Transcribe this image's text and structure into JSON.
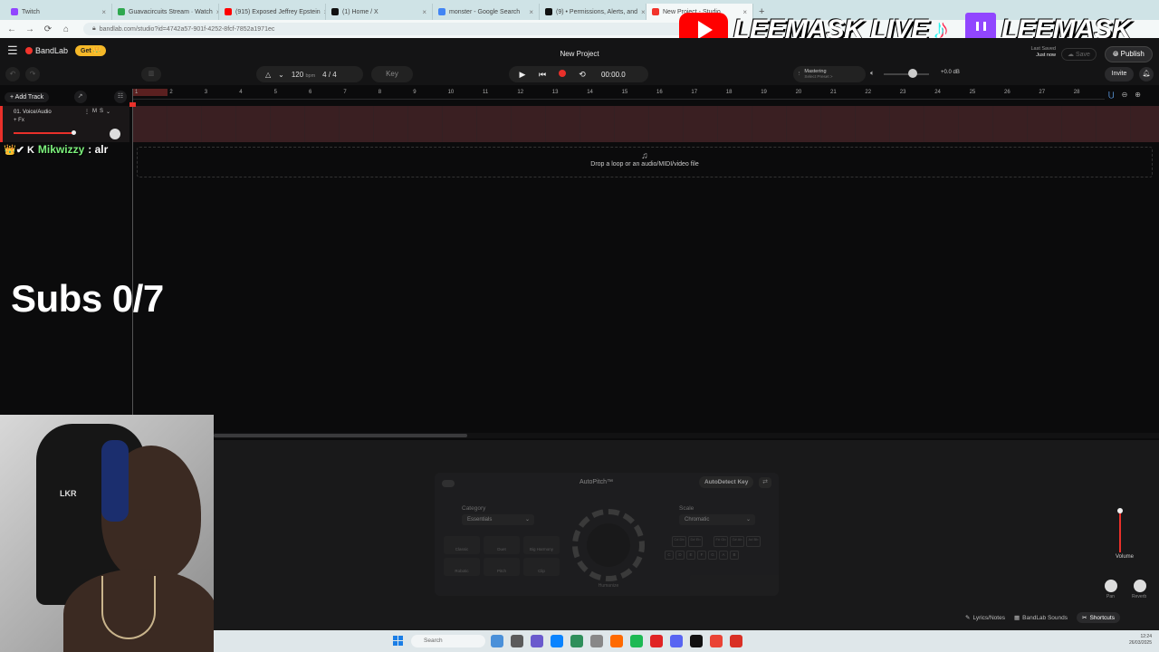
{
  "browser": {
    "tabs": [
      {
        "label": "Twitch",
        "color": "#9146ff"
      },
      {
        "label": "Guavacircuits Stream · Watch",
        "color": "#2fa84f"
      },
      {
        "label": "(915) Exposed Jeffrey Epstein",
        "color": "#ff0000"
      },
      {
        "label": "(1) Home / X",
        "color": "#111111"
      },
      {
        "label": "monster - Google Search",
        "color": "#4285f4"
      },
      {
        "label": "(9) • Permissions, Alerts, and",
        "color": "#111111"
      },
      {
        "label": "New Project - Studio",
        "color": "#f2342c",
        "active": true
      }
    ],
    "new_tab": "+",
    "url": "bandlab.com/studio?id=4742a57-901f-4252-8fcf-7852a1971ec",
    "nav": {
      "back": "←",
      "forward": "→",
      "reload": "⟳",
      "home": "⌂"
    }
  },
  "overlay": {
    "banner_left": "LEEMASK LIVE",
    "banner_right": "LEEMASK_",
    "chat_user": "Mikwizzy",
    "chat_message": ": alr",
    "chat_badges": "👑✔ K",
    "subs": "Subs 0/7"
  },
  "header": {
    "logo": "BandLab",
    "get_label": "Get 👑",
    "project_title": "New Project",
    "last_saved_label": "Last Saved",
    "last_saved_value": "Just now",
    "save_label": "Save",
    "publish_label": "Publish"
  },
  "transport": {
    "tempo": "120",
    "tempo_unit": "bpm",
    "time_signature": "4 / 4",
    "key_label": "Key",
    "time": "00:00.0",
    "mastering_label": "Mastering",
    "mastering_preset": "Select Preset >",
    "master_volume": 0.62,
    "volume_db": "+0.0 dB",
    "invite_label": "Invite"
  },
  "tracks": {
    "add_track_label": "Add Track",
    "items": [
      {
        "name": "01. Voice/Audio",
        "mute": "M",
        "solo": "S",
        "fx": "+ Fx",
        "volume": 0.88
      }
    ],
    "ruler": [
      "1",
      "2",
      "3",
      "4",
      "5",
      "6",
      "7",
      "8",
      "9",
      "10",
      "11",
      "12",
      "13",
      "14",
      "15",
      "16",
      "17",
      "18",
      "19",
      "20",
      "21",
      "22",
      "23",
      "24",
      "25",
      "26",
      "27",
      "28"
    ],
    "drop_text": "Drop a loop or an audio/MIDI/video file"
  },
  "autopitch": {
    "title": "AutoPitch™",
    "autodetect_label": "AutoDetect Key",
    "category_label": "Category",
    "category_value": "Essentials",
    "scale_label": "Scale",
    "scale_value": "Chromatic",
    "presets": [
      "Classic",
      "Duet",
      "Big Harmony",
      "Robotic",
      "Pitch",
      "Clip"
    ],
    "knob_label": "Humanize",
    "keys_top": [
      "C# Db",
      "D# Eb",
      "",
      "F# Gb",
      "G# Ab",
      "A# Bb"
    ],
    "keys": [
      "C",
      "D",
      "E",
      "F",
      "G",
      "A",
      "B"
    ]
  },
  "mixer": {
    "volume_label": "Volume",
    "volume_level": 0.36,
    "pan_label": "Pan",
    "reverb_label": "Reverb"
  },
  "footer": {
    "lyrics": "Lyrics/Notes",
    "sounds": "BandLab Sounds",
    "shortcuts": "Shortcuts"
  },
  "taskbar": {
    "search": "Search",
    "time": "12:24",
    "date": "26/03/2025"
  },
  "webcam": {
    "chair_logo": "LKR"
  }
}
